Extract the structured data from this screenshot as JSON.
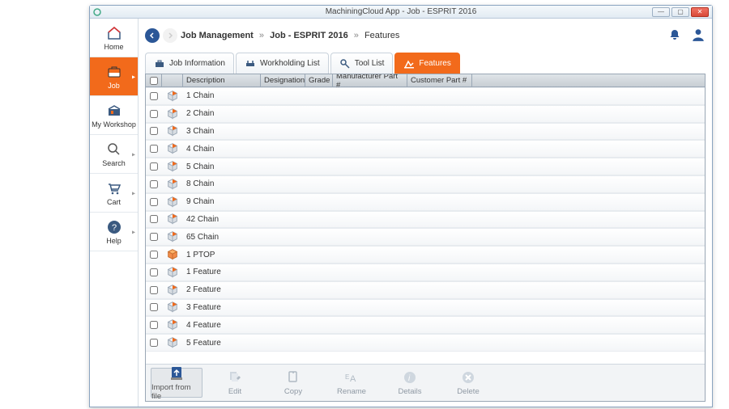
{
  "window": {
    "title": "MachiningCloud App - Job - ESPRIT 2016"
  },
  "breadcrumb": {
    "seg1": "Job Management",
    "seg2": "Job - ESPRIT 2016",
    "seg3": "Features"
  },
  "sidebar": {
    "items": [
      {
        "label": "Home",
        "active": false,
        "caret": false,
        "icon": "home-icon"
      },
      {
        "label": "Job",
        "active": true,
        "caret": true,
        "icon": "briefcase-icon"
      },
      {
        "label": "My Workshop",
        "active": false,
        "caret": false,
        "icon": "workshop-icon"
      },
      {
        "label": "Search",
        "active": false,
        "caret": true,
        "icon": "search-icon"
      },
      {
        "label": "Cart",
        "active": false,
        "caret": true,
        "icon": "cart-icon"
      },
      {
        "label": "Help",
        "active": false,
        "caret": true,
        "icon": "help-icon"
      }
    ]
  },
  "tabs": [
    {
      "label": "Job Information",
      "active": false,
      "icon": "briefcase-small-icon"
    },
    {
      "label": "Workholding List",
      "active": false,
      "icon": "vise-icon"
    },
    {
      "label": "Tool List",
      "active": false,
      "icon": "tool-icon"
    },
    {
      "label": "Features",
      "active": true,
      "icon": "features-icon"
    }
  ],
  "columns": {
    "description": "Description",
    "designation": "Designation",
    "grade": "Grade",
    "manufacturerPart": "Manufacturer Part #",
    "customerPart": "Customer Part #"
  },
  "rows": [
    {
      "desc": "1 Chain"
    },
    {
      "desc": "2 Chain"
    },
    {
      "desc": "3 Chain"
    },
    {
      "desc": "4 Chain"
    },
    {
      "desc": "5 Chain"
    },
    {
      "desc": "8 Chain"
    },
    {
      "desc": "9 Chain"
    },
    {
      "desc": "42 Chain"
    },
    {
      "desc": "65 Chain"
    },
    {
      "desc": "1 PTOP"
    },
    {
      "desc": "1 Feature"
    },
    {
      "desc": "2 Feature"
    },
    {
      "desc": "3 Feature"
    },
    {
      "desc": "4 Feature"
    },
    {
      "desc": "5 Feature"
    }
  ],
  "toolbar": {
    "import": "Import from file",
    "edit": "Edit",
    "copy": "Copy",
    "rename": "Rename",
    "details": "Details",
    "delete": "Delete"
  }
}
